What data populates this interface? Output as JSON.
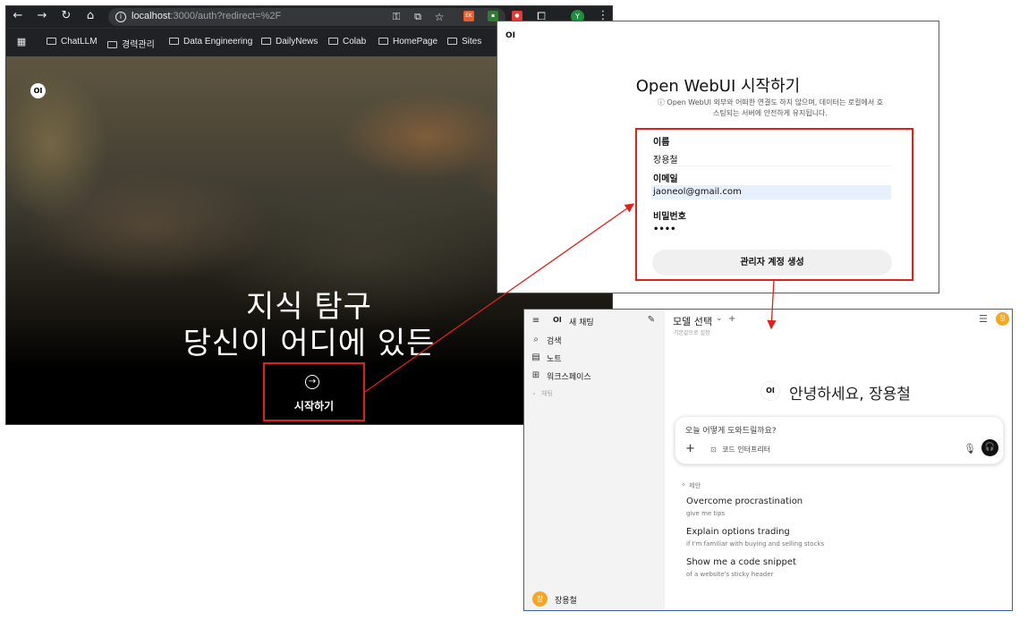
{
  "browser": {
    "url_host": "localhost",
    "url_path": ":3000/auth?redirect=%2F",
    "bookmarks": [
      "ChatLLM",
      "경력관리",
      "Data Engineering",
      "DailyNews",
      "Colab",
      "HomePage",
      "Sites"
    ],
    "profile_initial": "Y",
    "logo": "OI",
    "hero_line1": "지식 탐구",
    "hero_line2": "당신이 어디에 있든",
    "start_button": "시작하기",
    "colors": {
      "chrome": "#202124",
      "highlight": "#e0201c"
    }
  },
  "signup": {
    "logo": "OI",
    "title": "Open WebUI 시작하기",
    "notice_line1": "ⓘ Open WebUI 외부와 어떠한 연결도 하지 않으며, 데이터는 로컬에서 호",
    "notice_line2": "스팅되는 서버에 안전하게 유지됩니다.",
    "name_label": "이름",
    "name_value": "장용철",
    "email_label": "이메일",
    "email_value": "jaoneol@gmail.com",
    "password_label": "비밀번호",
    "password_value": "••••",
    "create_button": "관리자 계정 생성"
  },
  "chat": {
    "sidebar": {
      "logo": "OI",
      "new_chat": "새 채팅",
      "items": [
        "검색",
        "노트",
        "워크스페이스"
      ],
      "section_chats": "채팅",
      "user_name": "장용철",
      "user_initial": "장"
    },
    "header": {
      "model_select": "모델 선택",
      "set_default": "기본값으로 설정",
      "avatar_initial": "장"
    },
    "greeting_logo": "OI",
    "greeting": "안녕하세요, 장용철",
    "input_placeholder": "오늘 어떻게 도와드릴까요?",
    "code_interpreter": "코드 인터프리터",
    "suggestions_label": "제안",
    "suggestions": [
      {
        "title": "Overcome procrastination",
        "subtitle": "give me tips"
      },
      {
        "title": "Explain options trading",
        "subtitle": "if I'm familiar with buying and selling stocks"
      },
      {
        "title": "Show me a code snippet",
        "subtitle": "of a website's sticky header"
      }
    ],
    "colors": {
      "avatar": "#f5a623",
      "sidebar": "#f3f3f3"
    }
  }
}
